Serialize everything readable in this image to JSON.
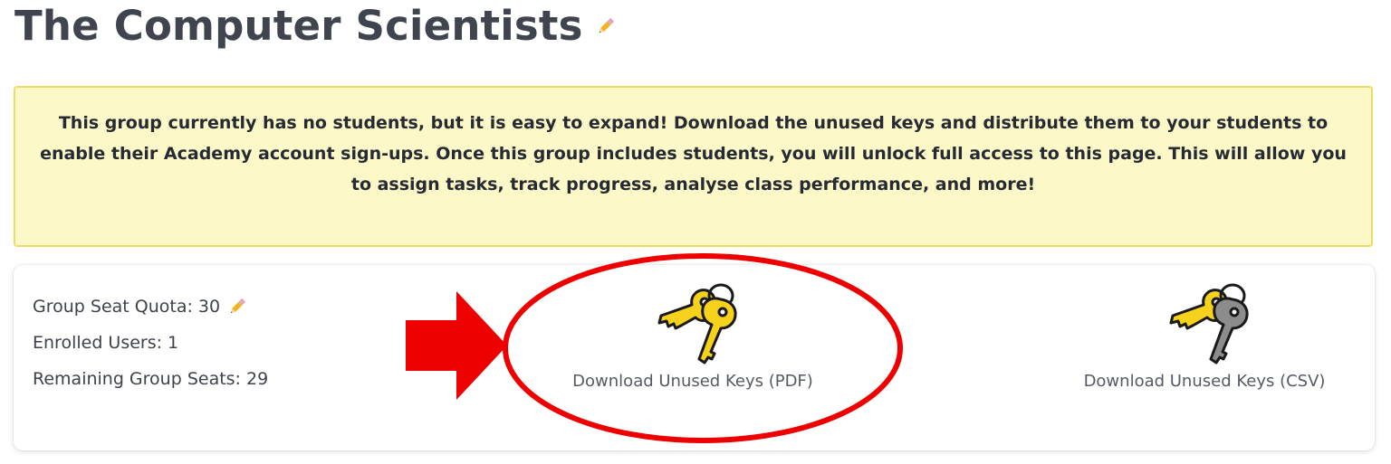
{
  "header": {
    "title": "The Computer Scientists"
  },
  "notice": {
    "text": "This group currently has no students, but it is easy to expand! Download the unused keys and distribute them to your students to enable their Academy account sign-ups. Once this group includes students, you will unlock full access to this page. This will allow you to assign tasks, track progress, analyse class performance, and more!"
  },
  "stats": {
    "seat_quota": "Group Seat Quota: 30",
    "enrolled_users": "Enrolled Users: 1",
    "remaining_seats": "Remaining Group Seats: 29"
  },
  "downloads": {
    "pdf_label": "Download Unused Keys (PDF)",
    "csv_label": "Download Unused Keys (CSV)"
  },
  "icons": {
    "edit": "pencil-icon",
    "pdf_keys": "keys-icon",
    "csv_keys": "keys-icon"
  },
  "colors": {
    "notice_bg": "#fdf8c7",
    "notice_border": "#eedd63",
    "key_yellow": "#f7d21c",
    "key_gray": "#8c8c8c",
    "annotation_red": "#ee0000"
  }
}
